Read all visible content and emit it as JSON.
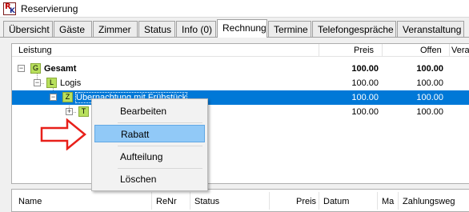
{
  "window": {
    "title": "Reservierung"
  },
  "tabs": [
    {
      "label": "Übersicht"
    },
    {
      "label": "Gäste"
    },
    {
      "label": "Zimmer"
    },
    {
      "label": "Status"
    },
    {
      "label": "Info (0)"
    },
    {
      "label": "Rechnung",
      "active": true
    },
    {
      "label": "Termine"
    },
    {
      "label": "Telefongespräche"
    },
    {
      "label": "Veranstaltung"
    }
  ],
  "tree": {
    "columns": {
      "leistung": "Leistung",
      "preis": "Preis",
      "offen": "Offen",
      "vera": "Vera"
    },
    "rows": [
      {
        "badge": "G",
        "label": "Gesamt",
        "preis": "100.00",
        "offen": "100.00"
      },
      {
        "badge": "L",
        "label": "Logis",
        "preis": "100.00",
        "offen": "100.00"
      },
      {
        "badge": "Z",
        "label": "Übernachtung mit Frühstück",
        "preis": "100.00",
        "offen": "100.00"
      },
      {
        "badge": "T",
        "label": "",
        "preis": "100.00",
        "offen": "100.00"
      }
    ],
    "expander_open": "−",
    "expander_closed": "+"
  },
  "context_menu": {
    "items": [
      {
        "label": "Bearbeiten"
      },
      {
        "label": "Rabatt",
        "highlighted": true
      },
      {
        "label": "Aufteilung"
      },
      {
        "label": "Löschen"
      }
    ]
  },
  "bottom_table": {
    "columns": [
      "Name",
      "ReNr",
      "Status",
      "Preis",
      "Datum",
      "Ma",
      "Zahlungsweg"
    ]
  },
  "colors": {
    "selection": "#0078d7",
    "menu_highlight": "#91c9f7",
    "badge": "#b8e05c",
    "arrow": "#e8201a"
  }
}
